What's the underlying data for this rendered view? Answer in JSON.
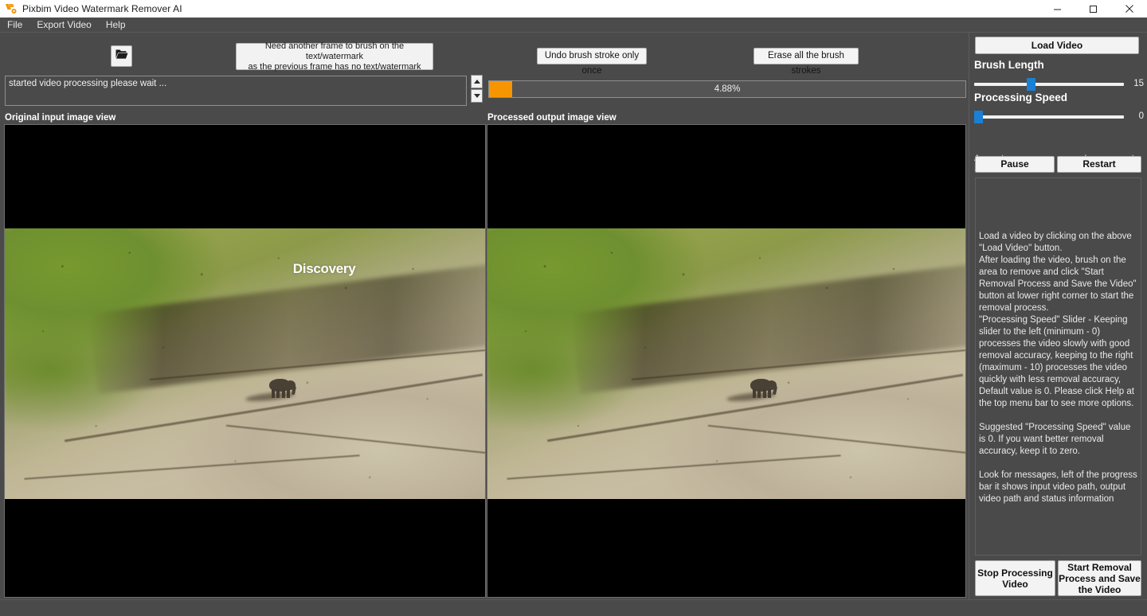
{
  "window": {
    "title": "Pixbim Video Watermark Remover AI",
    "icon": "pixbim-logo-icon",
    "controls": {
      "minimize": "minimize-icon",
      "maximize": "maximize-icon",
      "close": "close-icon"
    }
  },
  "menu": {
    "items": [
      {
        "label": "File"
      },
      {
        "label": "Export Video"
      },
      {
        "label": "Help"
      }
    ]
  },
  "toolbar": {
    "folder_icon": "open-folder-icon",
    "notice_line1": "Need another frame to brush on the text/watermark",
    "notice_line2": "as the previous frame has no text/watermark",
    "undo_label": "Undo brush stroke only once",
    "erase_label": "Erase all the brush strokes"
  },
  "log": {
    "line1": "started video processing please wait ...",
    "line2": "",
    "spinner_up": "spinner-up-icon",
    "spinner_down": "spinner-down-icon"
  },
  "progress": {
    "percent_label": "4.88%",
    "percent_value": 4.88,
    "fill_color": "#f79500"
  },
  "views": {
    "input_label": "Original input image view",
    "output_label": "Processed output image view",
    "watermark_text": "Discovery"
  },
  "sidebar": {
    "load_video_label": "Load Video",
    "brush_length": {
      "title": "Brush Length",
      "value": "15",
      "value_num": 15,
      "min": 0,
      "max": 40
    },
    "processing_speed": {
      "title": "Processing Speed",
      "value": "0",
      "value_num": 0,
      "min": 0,
      "max": 10,
      "hint_left_line1": "Accurate,",
      "hint_left_line2": "Slow",
      "hint_right_line1": "Less accurate,",
      "hint_right_line2": "Fast"
    },
    "pause_label": "Pause",
    "restart_label": "Restart",
    "help": {
      "p1": "Load a video by clicking on the above \"Load Video\" button.",
      "p2": "After loading the video, brush on the area to remove and click \"Start Removal Process and Save the Video\" button at lower right corner to start the removal process.",
      "p3": "\"Processing Speed\" Slider - Keeping slider to the left (minimum - 0) processes the video slowly with good removal accuracy, keeping to the right (maximum - 10) processes the video quickly with less removal accuracy, Default value is 0. Please click Help at the top menu bar to see more options.",
      "p4": "Suggested \"Processing Speed\" value is 0. If you want better removal accuracy, keep it to zero.",
      "p5": "Look for messages, left of the progress bar it shows input video path, output video path and status information"
    },
    "stop_label_line1": "Stop Processing",
    "stop_label_line2": "Video",
    "start_label_line1": "Start Removal",
    "start_label_line2": "Process and Save",
    "start_label_line3": "the Video"
  },
  "colors": {
    "accent": "#f79500",
    "slider": "#1b7fd4",
    "app_bg": "#4a4a4a",
    "panel_bg": "#000000"
  }
}
